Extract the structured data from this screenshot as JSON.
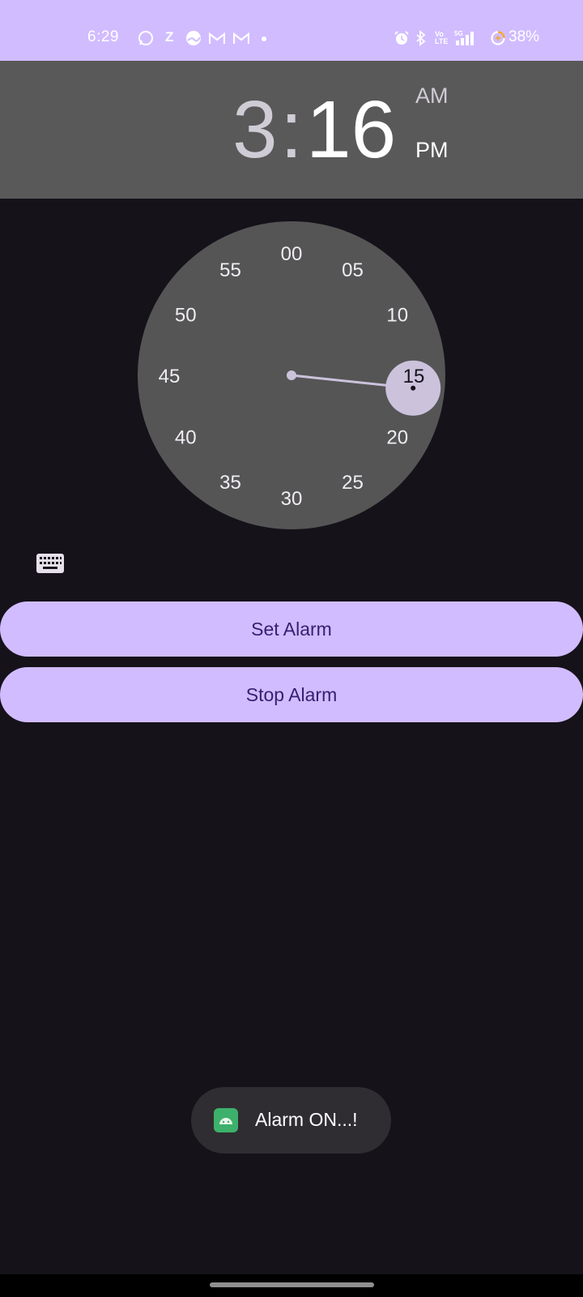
{
  "status_bar": {
    "time": "6:29",
    "notifications": [
      "whatsapp-icon",
      "z-app-icon",
      "weather-icon",
      "gmail-icon",
      "gmail-icon"
    ],
    "right_icons": [
      "alarm-icon",
      "bluetooth-icon",
      "volte-icon",
      "signal-5g-icon",
      "battery-saver-icon"
    ],
    "battery": "38%"
  },
  "time_picker": {
    "hour": "3",
    "separator": ":",
    "minute": "16",
    "am_label": "AM",
    "pm_label": "PM",
    "selected_period": "PM",
    "mode": "minute",
    "selected_minute": 16,
    "dial_labels": [
      "00",
      "05",
      "10",
      "15",
      "20",
      "25",
      "30",
      "35",
      "40",
      "45",
      "50",
      "55"
    ]
  },
  "keyboard_toggle": {
    "icon": "keyboard-icon"
  },
  "buttons": {
    "set_alarm": "Set Alarm",
    "stop_alarm": "Stop Alarm"
  },
  "toast": {
    "icon": "android-app-icon",
    "message": "Alarm ON...!"
  },
  "colors": {
    "accent": "#d1bcff",
    "on_accent": "#381e72",
    "background": "#15121a",
    "header": "#595959",
    "dial": "#555555",
    "selector": "#ccc2dc"
  }
}
